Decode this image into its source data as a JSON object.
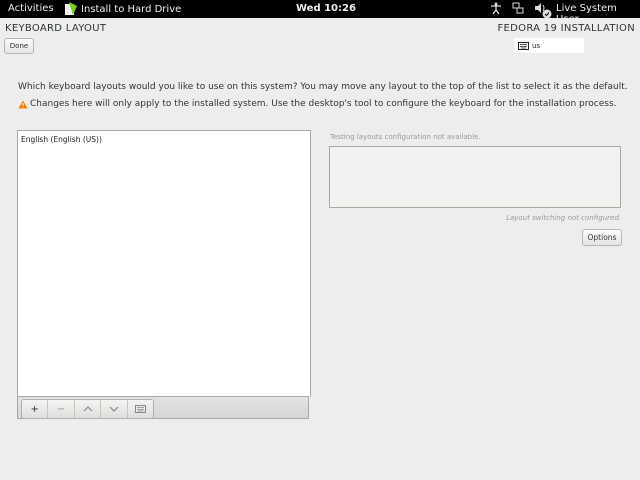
{
  "topbar": {
    "activities": "Activities",
    "app_name": "Install to Hard Drive",
    "clock": "Wed 10:26",
    "user": "Live System User",
    "icons": [
      "accessibility-icon",
      "network-icon",
      "volume-icon",
      "user-status-icon"
    ]
  },
  "header": {
    "title": "KEYBOARD LAYOUT",
    "done_label": "Done",
    "install_title": "FEDORA 19 INSTALLATION",
    "keyboard_indicator": "us"
  },
  "main": {
    "prompt": "Which keyboard layouts would you like to use on this system?  You may move any layout to the top of the list to select it as the default.",
    "warning": "Changes here will only apply to the installed system. Use the desktop's tool to configure the keyboard for the installation process.",
    "layouts": [
      "English (English (US))"
    ],
    "toolbar": {
      "add": "+",
      "remove": "−",
      "up": "∧",
      "down": "∨",
      "preview_icon": "keyboard-icon"
    },
    "testing_label": "Testing layouts configuration not available.",
    "switching_label": "Layout switching not configured.",
    "options_label": "Options"
  },
  "colors": {
    "background": "#ededed",
    "topbar": "#000000",
    "warning": "#f57900"
  }
}
